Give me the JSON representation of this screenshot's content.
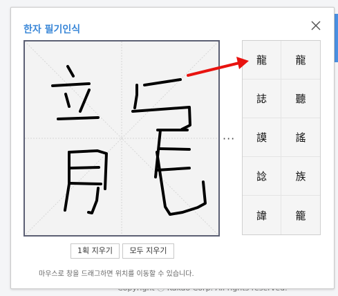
{
  "footer": {
    "text": "Copyright ⓒ Kakao Corp. All rights reserved."
  },
  "dialog": {
    "title": "한자 필기인식",
    "close_icon": "close-icon",
    "more_indicator": "···",
    "candidates": [
      "龍",
      "龍",
      "誌",
      "聽",
      "謨",
      "謠",
      "諗",
      "族",
      "諱",
      "籠"
    ],
    "buttons": {
      "undo_stroke": "1획 지우기",
      "clear_all": "모두 지우기"
    },
    "hint": "마우스로 창을 드래그하면 위치를 이동할 수 있습니다."
  },
  "colors": {
    "title": "#3a87d8",
    "annotation_arrow": "#e8130f",
    "canvas_border": "#5b5f73"
  }
}
